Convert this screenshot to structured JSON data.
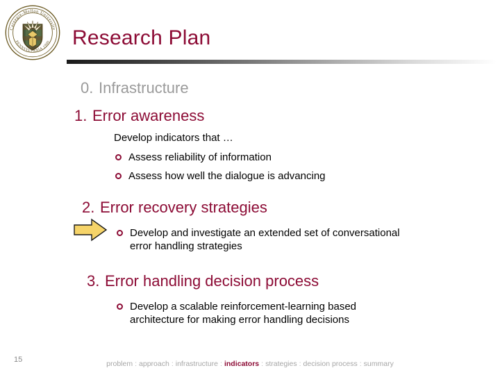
{
  "slide": {
    "title": "Research Plan",
    "page_number": "15",
    "accent_color": "#8C0B35",
    "dim_color": "#9a9a9a",
    "arrow_color": "#F6D469"
  },
  "logo": {
    "name": "carnegie-mellon-seal",
    "top_text": "Carnegie-Mellon University",
    "bottom_text": "PENNSYLVANIA 1900"
  },
  "outline": [
    {
      "num": "0.",
      "label": "Infrastructure",
      "state": "dim"
    },
    {
      "num": "1.",
      "label": "Error awareness",
      "state": "active"
    },
    {
      "num": "2.",
      "label": "Error recovery strategies",
      "state": "active"
    },
    {
      "num": "3.",
      "label": "Error handling decision process",
      "state": "active"
    }
  ],
  "section1": {
    "lead": "Develop indicators that …",
    "bullets": [
      "Assess reliability of information",
      "Assess how well the dialogue is advancing"
    ]
  },
  "section2": {
    "bullets": [
      "Develop and investigate an extended set of conversational error handling strategies"
    ]
  },
  "section3": {
    "bullets": [
      "Develop a scalable reinforcement-learning based architecture for making error handling decisions"
    ]
  },
  "footer": {
    "separator": ":",
    "crumbs": [
      {
        "label": "problem",
        "active": false
      },
      {
        "label": "approach",
        "active": false
      },
      {
        "label": "infrastructure",
        "active": false
      },
      {
        "label": "indicators",
        "active": true
      },
      {
        "label": "strategies",
        "active": false
      },
      {
        "label": "decision process",
        "active": false
      },
      {
        "label": "summary",
        "active": false
      }
    ]
  }
}
